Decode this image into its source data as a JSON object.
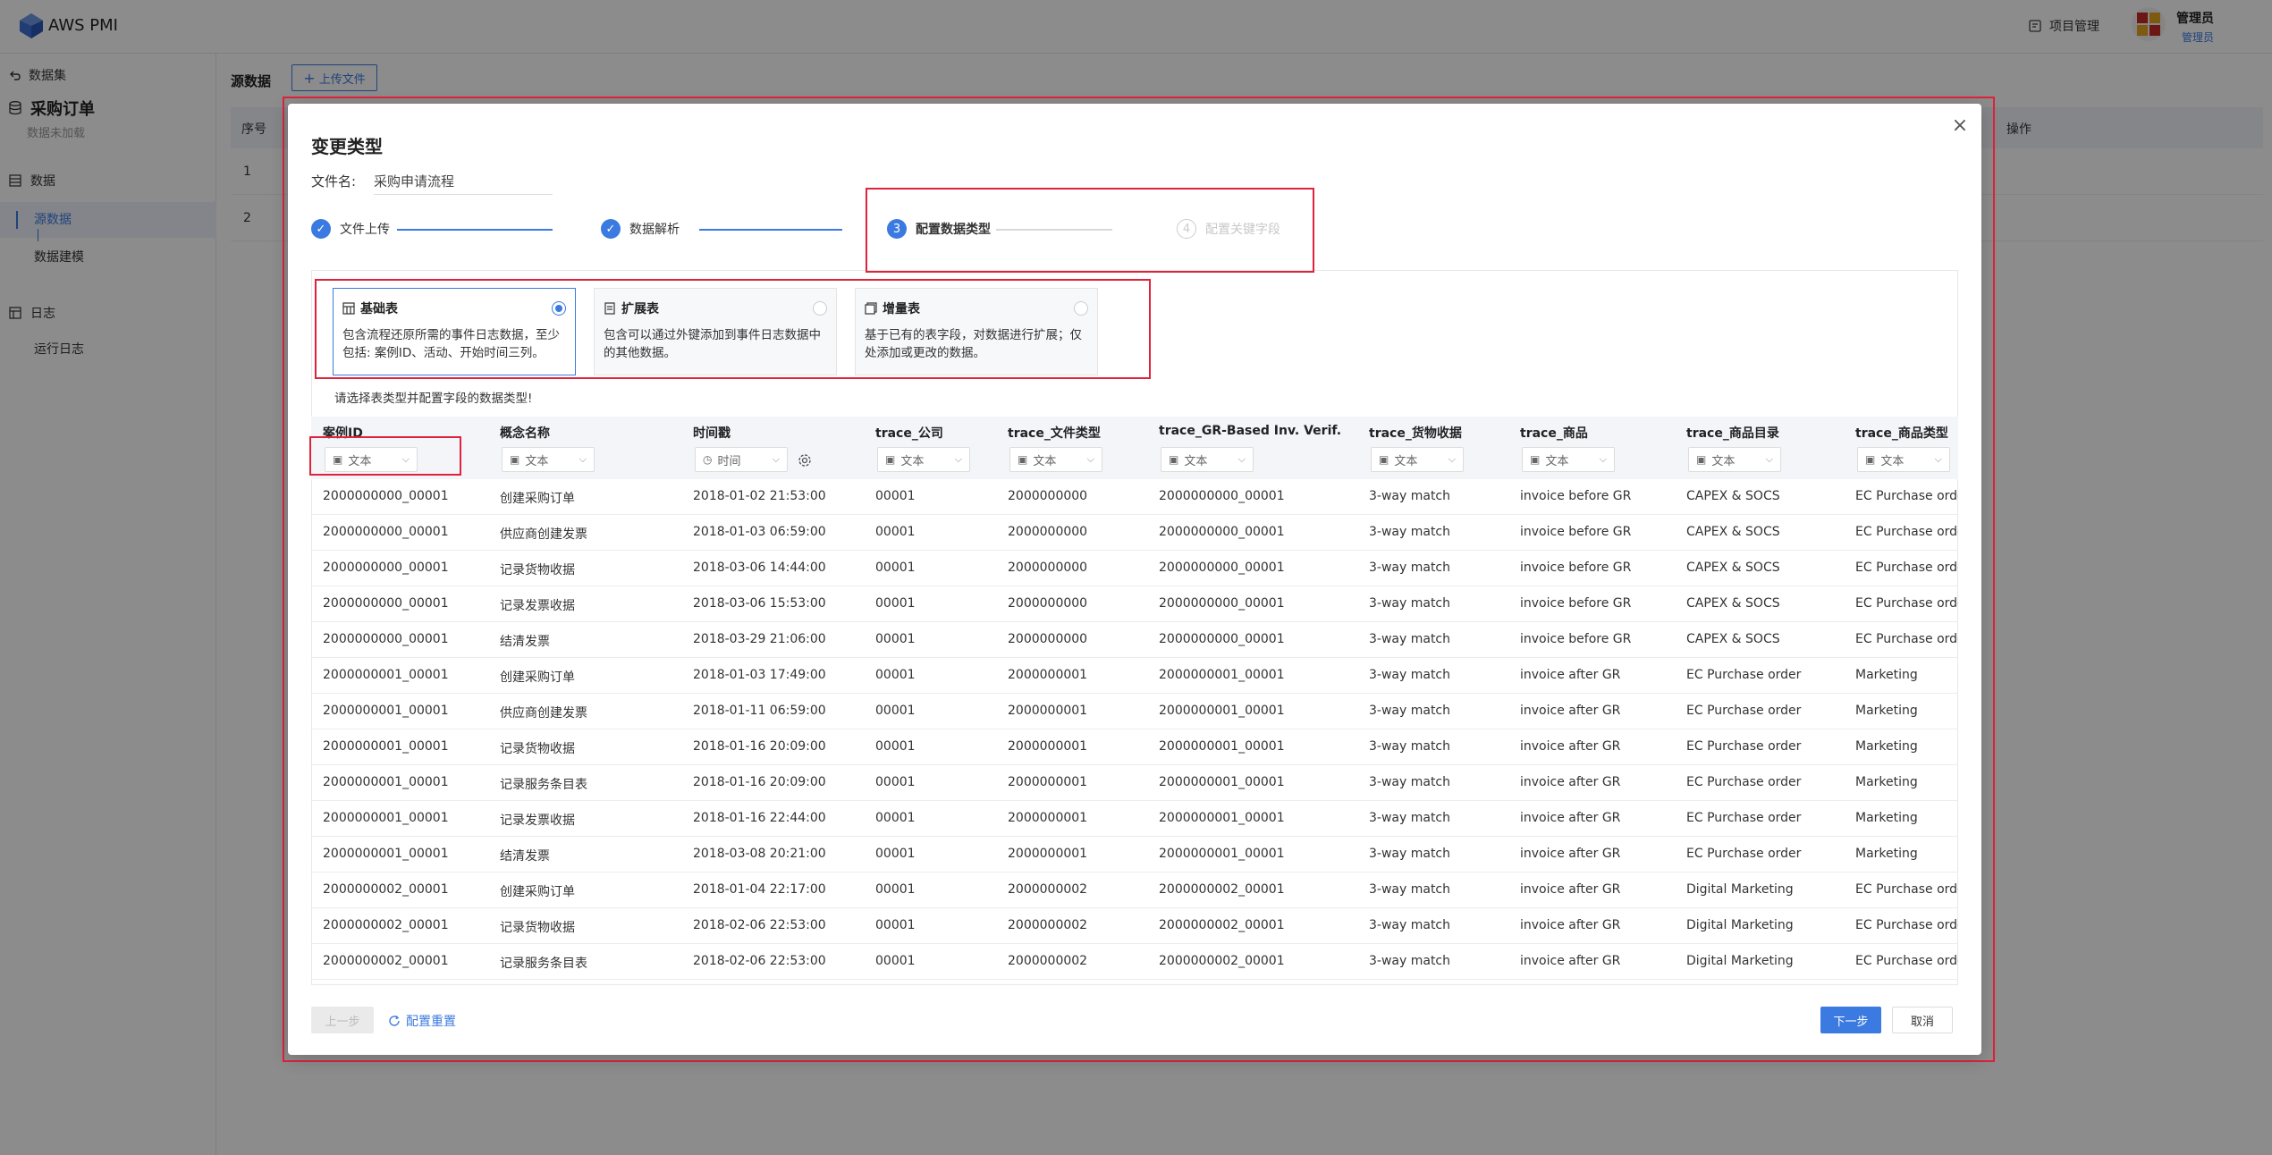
{
  "app": {
    "brand": "AWS PMI"
  },
  "header": {
    "project_mgmt": "项目管理",
    "user_name": "管理员",
    "user_role": "管理员"
  },
  "sidebar": {
    "back": "数据集",
    "title": "采购订单",
    "subtitle": "数据未加载",
    "section_data": "数据",
    "item_source": "源数据",
    "item_model": "数据建模",
    "section_log": "日志",
    "item_runlog": "运行日志"
  },
  "main": {
    "title": "源数据",
    "upload_label": "上传文件",
    "col_no": "序号",
    "col_op": "操作",
    "rows": [
      "1",
      "2"
    ]
  },
  "modal": {
    "title": "变更类型",
    "close": "×",
    "file_label": "文件名:",
    "file_name": "采购申请流程",
    "steps": [
      {
        "label": "文件上传",
        "mark": "✓"
      },
      {
        "label": "数据解析",
        "mark": "✓"
      },
      {
        "label": "配置数据类型",
        "mark": "3"
      },
      {
        "label": "配置关键字段",
        "mark": "4"
      }
    ],
    "types": [
      {
        "name": "基础表",
        "desc": "包含流程还原所需的事件日志数据，至少包括: 案例ID、活动、开始时间三列。"
      },
      {
        "name": "扩展表",
        "desc": "包含可以通过外键添加到事件日志数据中的其他数据。"
      },
      {
        "name": "增量表",
        "desc": "基于已有的表字段，对数据进行扩展；仅处添加或更改的数据。"
      }
    ],
    "hint": "请选择表类型并配置字段的数据类型!",
    "columns": [
      {
        "name": "案例ID",
        "type": "文本"
      },
      {
        "name": "概念名称",
        "type": "文本"
      },
      {
        "name": "时间戳",
        "type": "时间"
      },
      {
        "name": "trace_公司",
        "type": "文本"
      },
      {
        "name": "trace_文件类型",
        "type": "文本"
      },
      {
        "name": "trace_GR-Based Inv. Verif.",
        "type": "文本"
      },
      {
        "name": "trace_货物收据",
        "type": "文本"
      },
      {
        "name": "trace_商品",
        "type": "文本"
      },
      {
        "name": "trace_商品目录",
        "type": "文本"
      },
      {
        "name": "trace_商品类型",
        "type": "文本"
      }
    ],
    "rows": [
      [
        "2000000000_00001",
        "创建采购订单",
        "2018-01-02 21:53:00",
        "00001",
        "2000000000",
        "2000000000_00001",
        "3-way match",
        "invoice before GR",
        "CAPEX & SOCS",
        "EC Purchase order"
      ],
      [
        "2000000000_00001",
        "供应商创建发票",
        "2018-01-03 06:59:00",
        "00001",
        "2000000000",
        "2000000000_00001",
        "3-way match",
        "invoice before GR",
        "CAPEX & SOCS",
        "EC Purchase order"
      ],
      [
        "2000000000_00001",
        "记录货物收据",
        "2018-03-06 14:44:00",
        "00001",
        "2000000000",
        "2000000000_00001",
        "3-way match",
        "invoice before GR",
        "CAPEX & SOCS",
        "EC Purchase order"
      ],
      [
        "2000000000_00001",
        "记录发票收据",
        "2018-03-06 15:53:00",
        "00001",
        "2000000000",
        "2000000000_00001",
        "3-way match",
        "invoice before GR",
        "CAPEX & SOCS",
        "EC Purchase order"
      ],
      [
        "2000000000_00001",
        "结清发票",
        "2018-03-29 21:06:00",
        "00001",
        "2000000000",
        "2000000000_00001",
        "3-way match",
        "invoice before GR",
        "CAPEX & SOCS",
        "EC Purchase order"
      ],
      [
        "2000000001_00001",
        "创建采购订单",
        "2018-01-03 17:49:00",
        "00001",
        "2000000001",
        "2000000001_00001",
        "3-way match",
        "invoice after GR",
        "EC Purchase order",
        "Marketing"
      ],
      [
        "2000000001_00001",
        "供应商创建发票",
        "2018-01-11 06:59:00",
        "00001",
        "2000000001",
        "2000000001_00001",
        "3-way match",
        "invoice after GR",
        "EC Purchase order",
        "Marketing"
      ],
      [
        "2000000001_00001",
        "记录货物收据",
        "2018-01-16 20:09:00",
        "00001",
        "2000000001",
        "2000000001_00001",
        "3-way match",
        "invoice after GR",
        "EC Purchase order",
        "Marketing"
      ],
      [
        "2000000001_00001",
        "记录服务条目表",
        "2018-01-16 20:09:00",
        "00001",
        "2000000001",
        "2000000001_00001",
        "3-way match",
        "invoice after GR",
        "EC Purchase order",
        "Marketing"
      ],
      [
        "2000000001_00001",
        "记录发票收据",
        "2018-01-16 22:44:00",
        "00001",
        "2000000001",
        "2000000001_00001",
        "3-way match",
        "invoice after GR",
        "EC Purchase order",
        "Marketing"
      ],
      [
        "2000000001_00001",
        "结清发票",
        "2018-03-08 20:21:00",
        "00001",
        "2000000001",
        "2000000001_00001",
        "3-way match",
        "invoice after GR",
        "EC Purchase order",
        "Marketing"
      ],
      [
        "2000000002_00001",
        "创建采购订单",
        "2018-01-04 22:17:00",
        "00001",
        "2000000002",
        "2000000002_00001",
        "3-way match",
        "invoice after GR",
        "Digital Marketing",
        "EC Purchase order"
      ],
      [
        "2000000002_00001",
        "记录货物收据",
        "2018-02-06 22:53:00",
        "00001",
        "2000000002",
        "2000000002_00001",
        "3-way match",
        "invoice after GR",
        "Digital Marketing",
        "EC Purchase order"
      ],
      [
        "2000000002_00001",
        "记录服务条目表",
        "2018-02-06 22:53:00",
        "00001",
        "2000000002",
        "2000000002_00001",
        "3-way match",
        "invoice after GR",
        "Digital Marketing",
        "EC Purchase order"
      ]
    ],
    "buttons": {
      "prev": "上一步",
      "reset": "配置重置",
      "next": "下一步",
      "cancel": "取消"
    }
  },
  "colors": {
    "primary": "#3b7ae0",
    "highlight": "#e0223c"
  }
}
